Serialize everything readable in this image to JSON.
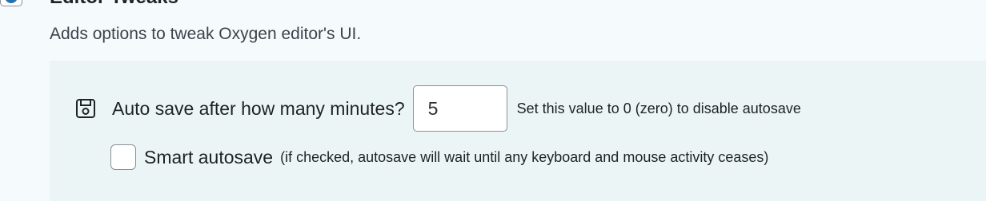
{
  "section": {
    "title": "Editor Tweaks",
    "enabled": true,
    "description": "Adds options to tweak Oxygen editor's UI."
  },
  "autosave": {
    "icon": "save-icon",
    "label": "Auto save after how many minutes?",
    "value": "5",
    "hint": "Set this value to 0 (zero) to disable autosave"
  },
  "smart_autosave": {
    "checked": false,
    "label": "Smart autosave",
    "hint": "(if checked, autosave will wait until any keyboard and mouse activity ceases)"
  },
  "colors": {
    "page_bg": "#f5fafd",
    "panel_bg": "#ecf5f6",
    "check_accent": "#2271b1",
    "border": "#8c8f94"
  }
}
